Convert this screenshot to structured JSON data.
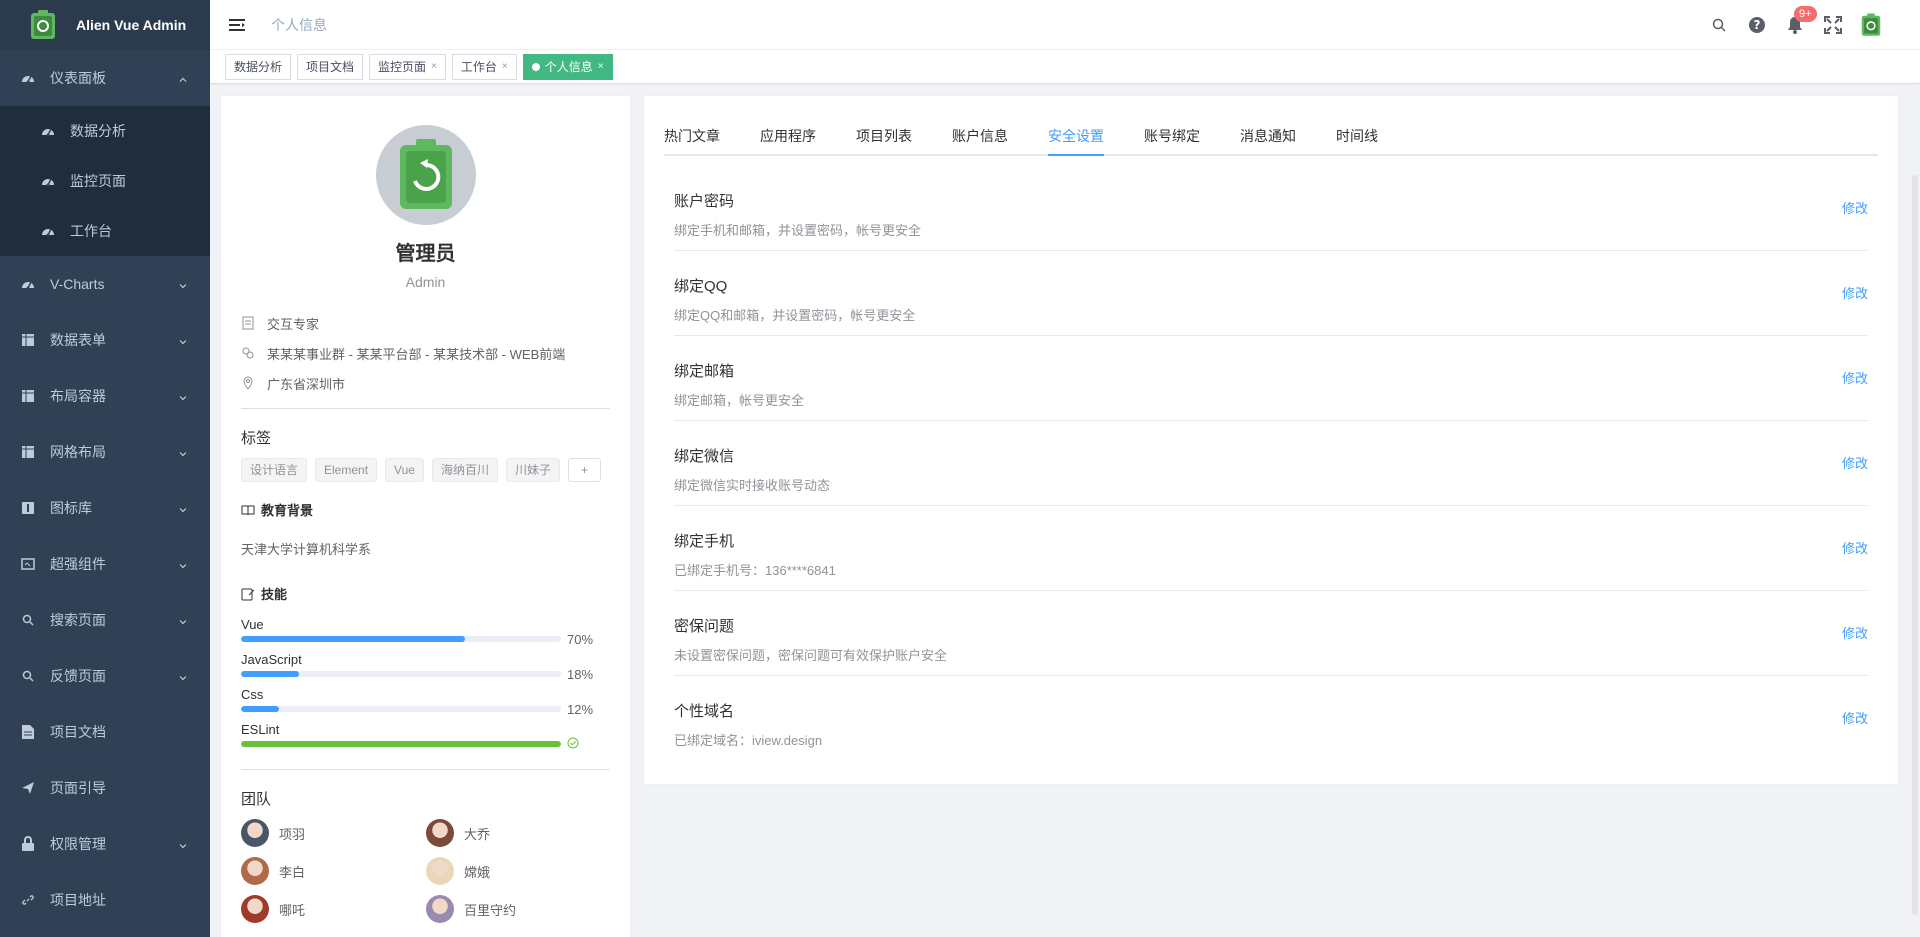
{
  "app": {
    "title": "Alien Vue Admin"
  },
  "sidebar": {
    "items": [
      {
        "label": "仪表面板",
        "icon": "dashboard-icon",
        "open": true,
        "children": [
          {
            "label": "数据分析",
            "icon": "dashboard-icon"
          },
          {
            "label": "监控页面",
            "icon": "dashboard-icon"
          },
          {
            "label": "工作台",
            "icon": "dashboard-icon"
          }
        ]
      },
      {
        "label": "V-Charts",
        "icon": "dashboard-icon"
      },
      {
        "label": "数据表单",
        "icon": "table-icon"
      },
      {
        "label": "布局容器",
        "icon": "table-icon"
      },
      {
        "label": "网格布局",
        "icon": "table-icon"
      },
      {
        "label": "图标库",
        "icon": "icon-library-icon"
      },
      {
        "label": "超强组件",
        "icon": "component-icon"
      },
      {
        "label": "搜索页面",
        "icon": "search-icon"
      },
      {
        "label": "反馈页面",
        "icon": "search-icon"
      },
      {
        "label": "项目文档",
        "icon": "document-icon"
      },
      {
        "label": "页面引导",
        "icon": "paper-plane-icon"
      },
      {
        "label": "权限管理",
        "icon": "lock-icon"
      },
      {
        "label": "项目地址",
        "icon": "link-icon"
      }
    ]
  },
  "navbar": {
    "breadcrumb": "个人信息",
    "notification_badge": "9+"
  },
  "tags_view": {
    "tags": [
      {
        "label": "数据分析",
        "closable": false,
        "active": false
      },
      {
        "label": "项目文档",
        "closable": false,
        "active": false
      },
      {
        "label": "监控页面",
        "closable": true,
        "active": false
      },
      {
        "label": "工作台",
        "closable": true,
        "active": false
      },
      {
        "label": "个人信息",
        "closable": true,
        "active": true
      }
    ],
    "close_glyph": "×"
  },
  "profile": {
    "name": "管理员",
    "role": "Admin",
    "info": {
      "title": "交互专家",
      "department": "某某某事业群 - 某某平台部 - 某某技术部 - WEB前端",
      "location": "广东省深圳市"
    },
    "tags_title": "标签",
    "tags": [
      "设计语言",
      "Element",
      "Vue",
      "海纳百川",
      "川妹子"
    ],
    "add_tag": "+",
    "education_title": "教育背景",
    "education": "天津大学计算机科学系",
    "skills_title": "技能",
    "skills": [
      {
        "name": "Vue",
        "percent": 70,
        "label": "70%"
      },
      {
        "name": "JavaScript",
        "percent": 18,
        "label": "18%"
      },
      {
        "name": "Css",
        "percent": 12,
        "label": "12%"
      },
      {
        "name": "ESLint",
        "percent": 100,
        "label": ""
      }
    ],
    "team_title": "团队",
    "team": [
      {
        "name": "项羽",
        "color": "#4a5568"
      },
      {
        "name": "大乔",
        "color": "#7a4a3a"
      },
      {
        "name": "李白",
        "color": "#b06a4a"
      },
      {
        "name": "嫦娥",
        "color": "#e8d8b8"
      },
      {
        "name": "哪吒",
        "color": "#a03a2a"
      },
      {
        "name": "百里守约",
        "color": "#9a8ab0"
      }
    ]
  },
  "tabs": [
    "热门文章",
    "应用程序",
    "项目列表",
    "账户信息",
    "安全设置",
    "账号绑定",
    "消息通知",
    "时间线"
  ],
  "active_tab_index": 4,
  "security": [
    {
      "title": "账户密码",
      "desc": "绑定手机和邮箱，并设置密码，帐号更安全",
      "action": "修改"
    },
    {
      "title": "绑定QQ",
      "desc": "绑定QQ和邮箱，并设置密码，帐号更安全",
      "action": "修改"
    },
    {
      "title": "绑定邮箱",
      "desc": "绑定邮箱，帐号更安全",
      "action": "修改"
    },
    {
      "title": "绑定微信",
      "desc": "绑定微信实时接收账号动态",
      "action": "修改"
    },
    {
      "title": "绑定手机",
      "desc": "已绑定手机号：136****6841",
      "action": "修改"
    },
    {
      "title": "密保问题",
      "desc": "未设置密保问题，密保问题可有效保护账户安全",
      "action": "修改"
    },
    {
      "title": "个性域名",
      "desc": "已绑定域名：iview.design",
      "action": "修改"
    }
  ],
  "colors": {
    "sidebar_bg": "#304156",
    "submenu_bg": "#1f2d3d",
    "accent": "#409eff",
    "active_tag": "#42b983",
    "brand_green": "#5fb85f"
  }
}
